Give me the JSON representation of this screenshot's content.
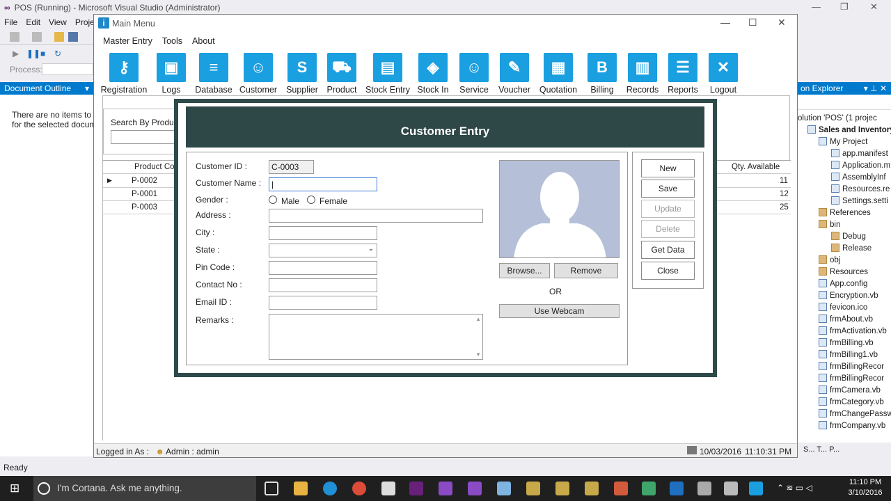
{
  "vs": {
    "title": "POS (Running) - Microsoft Visual Studio (Administrator)",
    "menu": [
      "File",
      "Edit",
      "View",
      "Proje"
    ],
    "process_label": "Process:",
    "doc_outline_title": "Document Outline",
    "doc_outline_msg1": "There are no items to sh",
    "doc_outline_msg2": "for the selected docum",
    "solution_title": "on Explorer",
    "solution_items": [
      "olution 'POS' (1 projec",
      "Sales and Inventory",
      "My Project",
      "app.manifest",
      "Application.m",
      "AssemblyInf",
      "Resources.re",
      "Settings.setti",
      "References",
      "bin",
      "Debug",
      "Release",
      "obj",
      "Resources",
      "App.config",
      "Encryption.vb",
      "fevicon.ico",
      "frmAbout.vb",
      "frmActivation.vb",
      "frmBilling.vb",
      "frmBilling1.vb",
      "frmBillingRecor",
      "frmBillingRecor",
      "frmCamera.vb",
      "frmCategory.vb",
      "frmChangePassw",
      "frmCompany.vb"
    ],
    "sol_tabs": "S...   T...   P...",
    "status": "Ready"
  },
  "main": {
    "title": "Main Menu",
    "menu": [
      "Master Entry",
      "Tools",
      "About"
    ],
    "toolbar": [
      {
        "label": "Registration",
        "icon": "key-icon",
        "glyph": "⚷"
      },
      {
        "label": "Logs",
        "icon": "id-card-icon",
        "glyph": "▣"
      },
      {
        "label": "Database",
        "icon": "database-icon",
        "glyph": "≡"
      },
      {
        "label": "Customer",
        "icon": "add-user-icon",
        "glyph": "☺"
      },
      {
        "label": "Supplier",
        "icon": "supplier-icon",
        "glyph": "S"
      },
      {
        "label": "Product",
        "icon": "cart-icon",
        "glyph": "⛟"
      },
      {
        "label": "Stock Entry",
        "icon": "archive-icon",
        "glyph": "▤"
      },
      {
        "label": "Stock In",
        "icon": "tag-icon",
        "glyph": "◈"
      },
      {
        "label": "Service",
        "icon": "smile-icon",
        "glyph": "☺"
      },
      {
        "label": "Voucher",
        "icon": "voucher-icon",
        "glyph": "✎"
      },
      {
        "label": "Quotation",
        "icon": "document-icon",
        "glyph": "▦"
      },
      {
        "label": "Billing",
        "icon": "billing-icon",
        "glyph": "B"
      },
      {
        "label": "Records",
        "icon": "book-icon",
        "glyph": "▥"
      },
      {
        "label": "Reports",
        "icon": "report-icon",
        "glyph": "☰"
      },
      {
        "label": "Logout",
        "icon": "close-icon",
        "glyph": "✕"
      }
    ],
    "search_label": "Search By Product N",
    "grid": {
      "col_code": "Product Code",
      "col_qty": "Qty. Available",
      "rows": [
        {
          "code": "P-0002",
          "qty": "11"
        },
        {
          "code": "P-0001",
          "qty": "12"
        },
        {
          "code": "P-0003",
          "qty": "25"
        }
      ]
    },
    "status": {
      "logged_in_label": "Logged in As :",
      "role": "Admin",
      "user": "admin",
      "date": "10/03/2016",
      "time": "11:10:31 PM"
    }
  },
  "customer": {
    "title": "Customer Entry",
    "labels": {
      "id": "Customer ID :",
      "name": "Customer Name :",
      "gender": "Gender :",
      "address": "Address :",
      "city": "City :",
      "state": "State :",
      "pin": "Pin Code :",
      "contact": "Contact No :",
      "email": "Email ID :",
      "remarks": "Remarks :"
    },
    "id_value": "C-0003",
    "male": "Male",
    "female": "Female",
    "browse": "Browse...",
    "remove": "Remove",
    "or": "OR",
    "webcam": "Use Webcam",
    "buttons": {
      "new": "New",
      "save": "Save",
      "update": "Update",
      "delete": "Delete",
      "get_data": "Get Data",
      "close": "Close"
    }
  },
  "taskbar": {
    "cortana": "I'm Cortana. Ask me anything.",
    "time": "11:10 PM",
    "date": "3/10/2016"
  }
}
